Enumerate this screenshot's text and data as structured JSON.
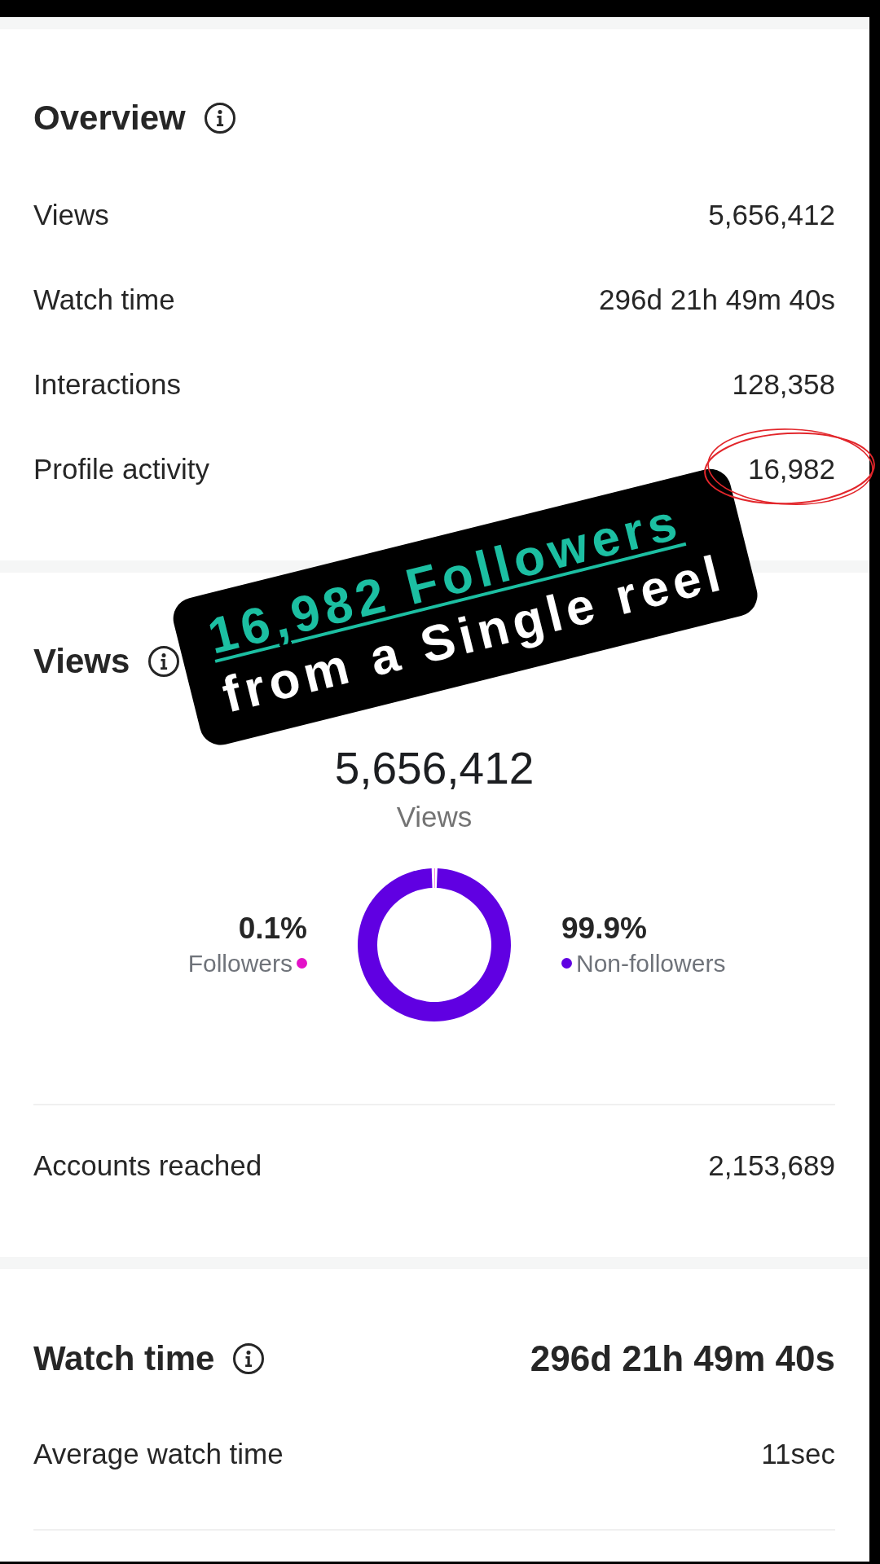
{
  "overview": {
    "title": "Overview",
    "rows": [
      {
        "label": "Views",
        "value": "5,656,412",
        "circled": false
      },
      {
        "label": "Watch time",
        "value": "296d 21h 49m 40s",
        "circled": false
      },
      {
        "label": "Interactions",
        "value": "128,358",
        "circled": false
      },
      {
        "label": "Profile activity",
        "value": "16,982",
        "circled": true
      }
    ]
  },
  "sticker": {
    "headline": "16,982 Followers",
    "subline": "from a Single reel"
  },
  "views": {
    "title": "Views",
    "total": "5,656,412",
    "total_label": "Views",
    "breakdown": [
      {
        "percent": "0.1%",
        "color": "#e312c8"
      },
      {
        "percent": "99.9%",
        "color": "#6000e2"
      }
    ],
    "chart_data": {
      "type": "donut",
      "categories": [
        "Followers",
        "Non-followers"
      ],
      "values": [
        0.1,
        99.9
      ]
    },
    "rows": [
      {
        "label": "Accounts reached",
        "value": "2,153,689"
      }
    ]
  },
  "watch_time": {
    "title": "Watch time",
    "total": "296d 21h 49m 40s",
    "rows": [
      {
        "label": "Average watch time",
        "value": "11sec"
      }
    ]
  }
}
